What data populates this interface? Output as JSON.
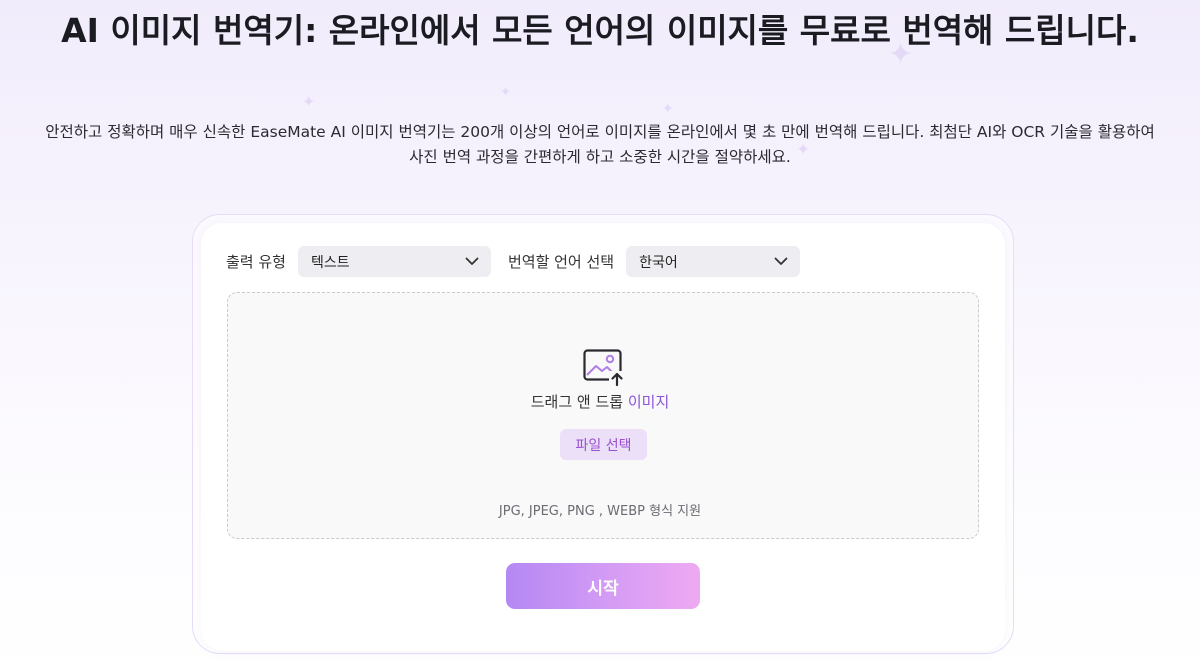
{
  "hero": {
    "title": "AI 이미지 번역기: 온라인에서 모든 언어의 이미지를 무료로 번역해 드립니다.",
    "subtitle_line1": "안전하고 정확하며 매우 신속한 EaseMate AI 이미지 번역기는 200개 이상의 언어로 이미지를 온라인에서 몇 초 만에 번역해 드립니다. 최첨단 AI와 OCR 기술을 활용하여",
    "subtitle_line2": "사진 번역 과정을 간편하게 하고 소중한 시간을 절약하세요."
  },
  "controls": {
    "output_type_label": "출력 유형",
    "output_type_value": "텍스트",
    "language_label": "번역할 언어 선택",
    "language_value": "한국어"
  },
  "dropzone": {
    "text": "드래그 앤 드롭",
    "text_accent": "이미지",
    "file_button": "파일 선택",
    "formats": "JPG, JPEG, PNG , WEBP 형식 지원"
  },
  "start_button": "시작",
  "colors": {
    "accent": "#8a54d8",
    "button_gradient_start": "#b488f3",
    "button_gradient_end": "#efa9f2"
  },
  "icons": {
    "upload": "image-upload-icon",
    "dropdown": "chevron-down-icon",
    "decor": "sparkle-icon"
  }
}
